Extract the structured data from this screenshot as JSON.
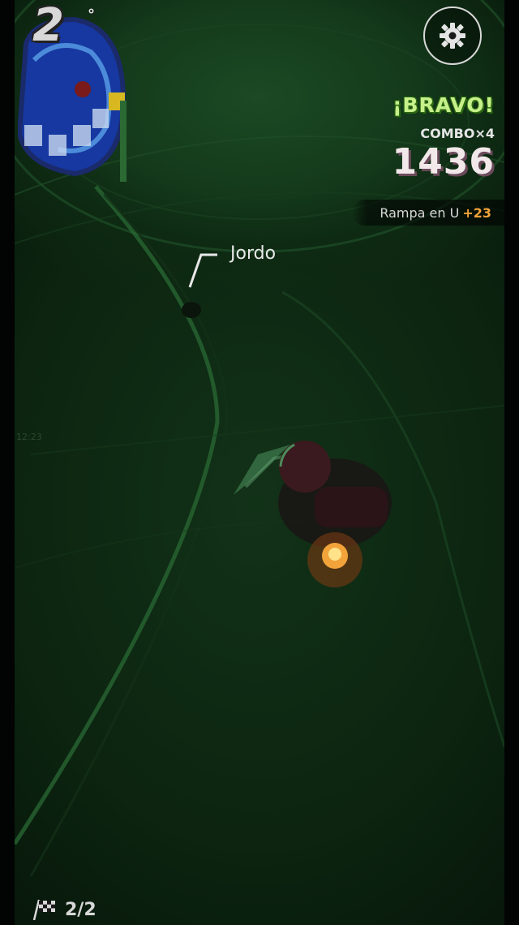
{
  "race": {
    "position": "2",
    "position_suffix": "°",
    "lap": "2/2"
  },
  "combo": {
    "praise": "¡BRAVO!",
    "combo_label": "COMBO×4",
    "score": "1436"
  },
  "trick": {
    "name": "Rampa en U",
    "points": "+23"
  },
  "rival": {
    "name": "Jordo"
  },
  "timer": {
    "partial": "12:23"
  },
  "colors": {
    "praise": "#c6f08a",
    "points": "#f2a33a",
    "track": "#0e2a13"
  },
  "icons": {
    "settings": "gear-icon",
    "lap": "checkered-flag-icon"
  }
}
